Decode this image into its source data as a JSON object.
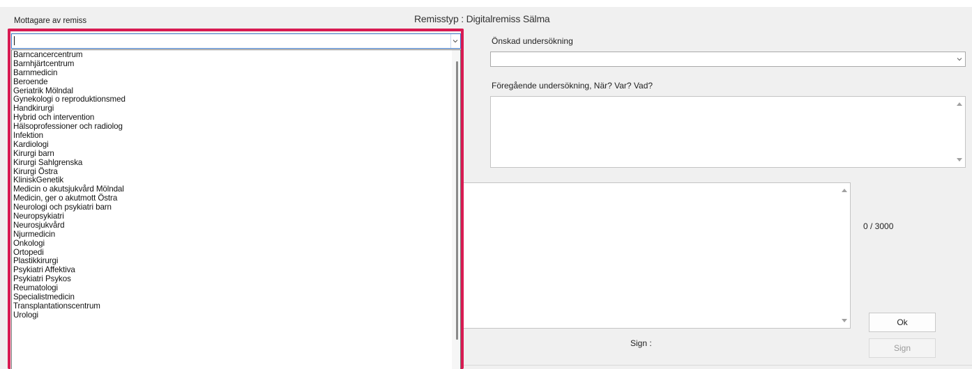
{
  "header": {
    "recipient_label": "Mottagare av remiss",
    "remisstyp_text": "Remisstyp : Digitalremiss Sälma"
  },
  "form": {
    "desired_exam_label": "Önskad undersökning",
    "desired_exam_value": "",
    "previous_exam_label": "Föregående undersökning, När? Var? Vad?",
    "char_counter": "0 / 3000",
    "sign_label": "Sign :"
  },
  "buttons": {
    "ok": "Ok",
    "sign": "Sign"
  },
  "recipient_dropdown": {
    "value": "",
    "open": true,
    "options": [
      "Barncancercentrum",
      "Barnhjärtcentrum",
      "Barnmedicin",
      "Beroende",
      "Geriatrik Mölndal",
      "Gynekologi o reproduktionsmed",
      "Handkirurgi",
      "Hybrid och intervention",
      "Hälsoprofessioner och radiolog",
      "Infektion",
      "Kardiologi",
      "Kirurgi barn",
      "Kirurgi Sahlgrenska",
      "Kirurgi Östra",
      "KliniskGenetik",
      "Medicin o akutsjukvård Mölndal",
      "Medicin, ger o akutmott Östra",
      "Neurologi och psykiatri barn",
      "Neuropsykiatri",
      "Neurosjukvård",
      "Njurmedicin",
      "Onkologi",
      "Ortopedi",
      "Plastikkirurgi",
      "Psykiatri Affektiva",
      "Psykiatri Psykos",
      "Reumatologi",
      "Specialistmedicin",
      "Transplantationscentrum",
      "Urologi"
    ]
  },
  "colors": {
    "highlight_frame": "#d81b52",
    "focus_border": "#3c78c8",
    "background": "#f0f0f0"
  }
}
